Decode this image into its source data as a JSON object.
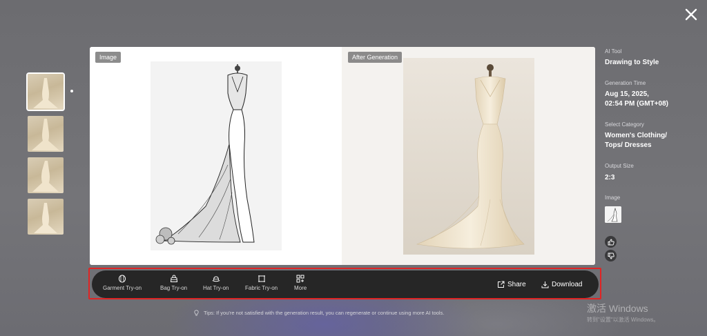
{
  "colors": {
    "backdrop": "#6f6f73",
    "toolbar_bg": "#262626",
    "highlight_border": "#e02424",
    "card_bg": "#ffffff"
  },
  "icons": {
    "close": "close-icon",
    "garment": "garment-icon",
    "bag": "bag-icon",
    "hat": "hat-icon",
    "fabric": "fabric-icon",
    "more": "grid-plus-icon",
    "share": "share-icon",
    "download": "download-icon",
    "like": "thumbs-up-icon",
    "dislike": "thumbs-down-icon",
    "tip": "lightbulb-icon"
  },
  "preview": {
    "left_label": "Image",
    "right_label": "After Generation"
  },
  "info": {
    "tool_label": "AI Tool",
    "tool_value": "Drawing to Style",
    "time_label": "Generation Time",
    "time_value_line1": "Aug 15, 2025,",
    "time_value_line2": "02:54 PM (GMT+08)",
    "category_label": "Select Category",
    "category_value_line1": "Women's Clothing/",
    "category_value_line2": "Tops/ Dresses",
    "size_label": "Output Size",
    "size_value": "2:3",
    "image_label": "Image"
  },
  "toolbar": {
    "tools": [
      {
        "label": "Garment Try-on"
      },
      {
        "label": "Bag Try-on"
      },
      {
        "label": "Hat Try-on"
      },
      {
        "label": "Fabric Try-on"
      },
      {
        "label": "More"
      }
    ],
    "share_label": "Share",
    "download_label": "Download"
  },
  "tips": {
    "text": "Tips: If you're not satisfied with the generation result, you can regenerate or continue using more AI tools."
  },
  "watermark": {
    "title": "激活 Windows",
    "subtitle": "转到\"设置\"以激活 Windows。"
  }
}
